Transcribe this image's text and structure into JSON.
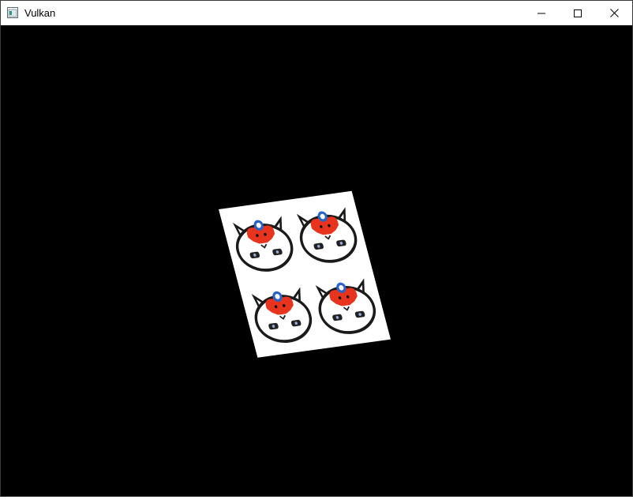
{
  "window": {
    "title": "Vulkan",
    "icon": "app-window-icon",
    "controls": {
      "minimize": "minimize-icon",
      "maximize": "maximize-icon",
      "close": "close-icon"
    }
  },
  "viewport": {
    "background": "#000000",
    "content": "textured-quad",
    "texture": {
      "tiles": 4,
      "tile_icon": "cartoon-mascot-icon",
      "colors": {
        "mascot": "#e8341c",
        "badge": "#2a64c8",
        "outline": "#1a1a1a",
        "paper": "#ffffff"
      }
    }
  }
}
